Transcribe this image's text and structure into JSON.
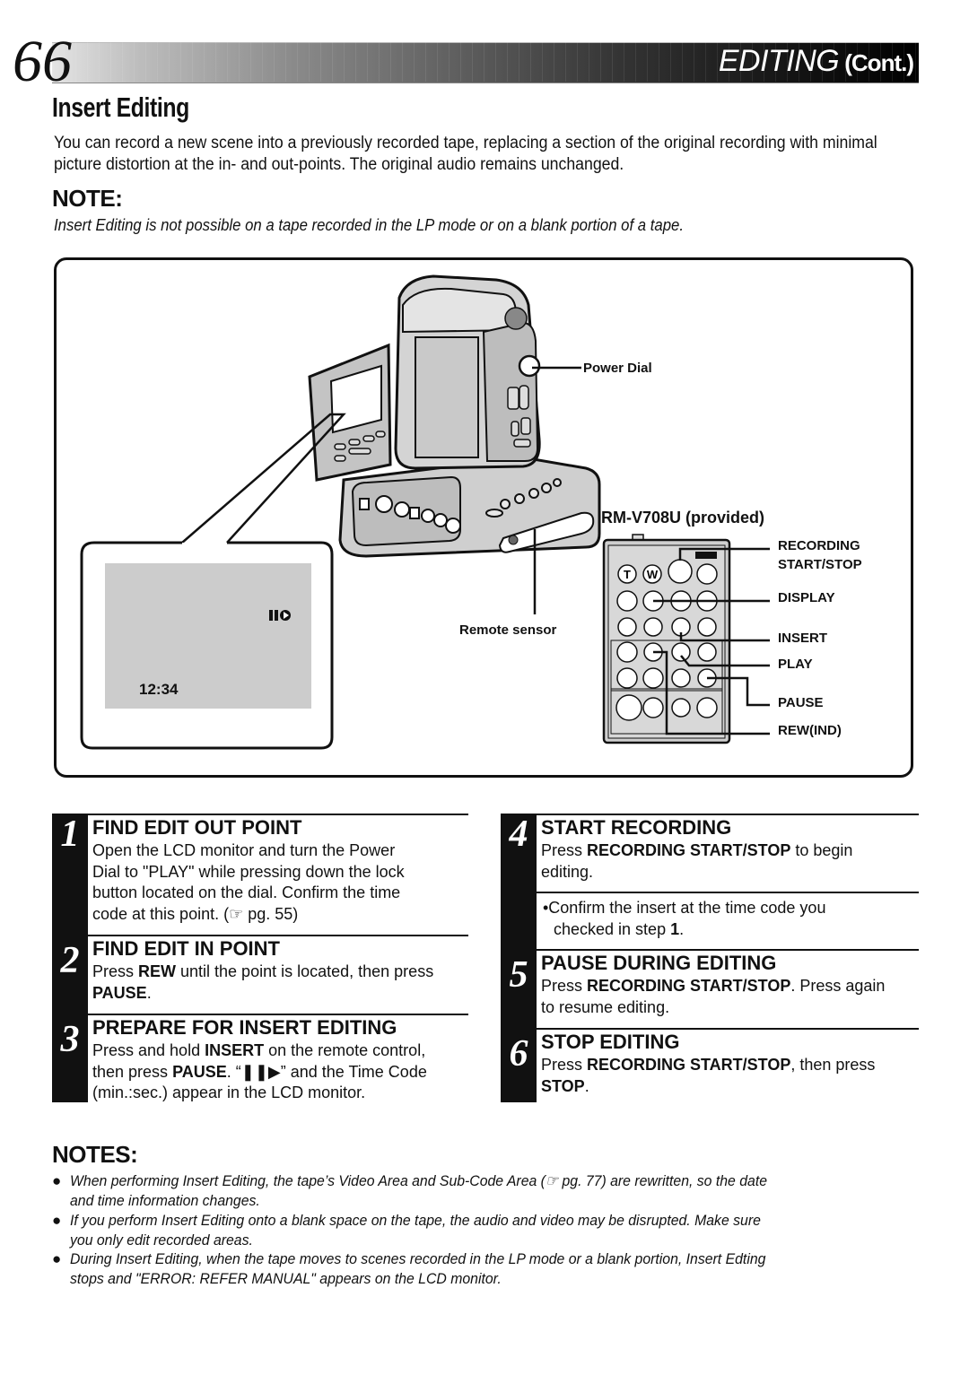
{
  "header": {
    "page_number": "66",
    "section": "EDITING",
    "section_suffix": "(Cont.)"
  },
  "page_heading": "Insert Editing",
  "intro": "You can record a new scene into a previously recorded tape, replacing a section of the original recording with minimal picture distortion at the in- and out-points. The original audio remains unchanged.",
  "note": {
    "title": "NOTE:",
    "text": "Insert Editing is not possible on a tape recorded in the LP mode or on a blank portion of a tape."
  },
  "figure": {
    "power_dial_label": "Power Dial",
    "remote_sensor_label": "Remote sensor",
    "remote_model_label": "RM-V708U (provided)",
    "lcd_time_code": "12:34",
    "lcd_icon": "pause-insert-icon",
    "remote_callouts": {
      "recording_line1": "RECORDING",
      "recording_line2": "START/STOP",
      "display": "DISPLAY",
      "insert": "INSERT",
      "play": "PLAY",
      "pause": "PAUSE",
      "rewind": "REW(IND)"
    },
    "remote_keys": {
      "t": "T",
      "w": "W"
    }
  },
  "steps": [
    {
      "number": "1",
      "title": "FIND EDIT OUT POINT",
      "body_lines": [
        "Open the LCD monitor and turn the Power",
        "Dial to \"PLAY\" while pressing down the lock",
        "button located on the dial. Confirm the time",
        "code at this point. (☞ pg. 55)"
      ]
    },
    {
      "number": "2",
      "title": "FIND EDIT IN POINT",
      "body_pre": "Press ",
      "body_b1": "REW",
      "body_mid": " until the point is located, then press",
      "body_b2": "PAUSE",
      "body_end": "."
    },
    {
      "number": "3",
      "title": "PREPARE FOR INSERT EDITING",
      "l1_pre": "Press and hold ",
      "l1_b": "INSERT",
      "l1_post": " on the remote control,",
      "l2_pre": "then press ",
      "l2_b": "PAUSE",
      "l2_post": ". “❚❚▶” and the Time Code",
      "l3": "(min.:sec.) appear in the LCD monitor."
    },
    {
      "number": "4",
      "title": "START RECORDING",
      "l1_pre": "Press ",
      "l1_b": "RECORDING START/STOP",
      "l1_post": " to begin",
      "l2": "editing.",
      "bullet_l1": "•Confirm the insert at the time code you",
      "bullet_l2_pre": "checked in step ",
      "bullet_l2_b": "1",
      "bullet_l2_post": "."
    },
    {
      "number": "5",
      "title": "PAUSE DURING EDITING",
      "l1_pre": "Press ",
      "l1_b": "RECORDING START/STOP",
      "l1_post": ". Press again",
      "l2": "to resume editing."
    },
    {
      "number": "6",
      "title": "STOP EDITING",
      "l1_pre": "Press ",
      "l1_b": "RECORDING START/STOP",
      "l1_post": ", then press",
      "l2_b": "STOP",
      "l2_post": "."
    }
  ],
  "notes": {
    "title": "NOTES:",
    "items": [
      {
        "l1": "When performing Insert Editing, the tape’s Video Area and Sub-Code Area (☞ pg. 77) are rewritten, so the date",
        "l2": "and time information changes."
      },
      {
        "l1": "If you perform Insert Editing onto a blank space on the tape, the audio and video may be disrupted. Make sure",
        "l2": "you only edit recorded areas."
      },
      {
        "l1": "During Insert Editing, when the tape moves to scenes recorded in the LP mode or a blank portion, Insert Edting",
        "l2": "stops and \"ERROR: REFER MANUAL\" appears on the LCD monitor."
      }
    ]
  }
}
